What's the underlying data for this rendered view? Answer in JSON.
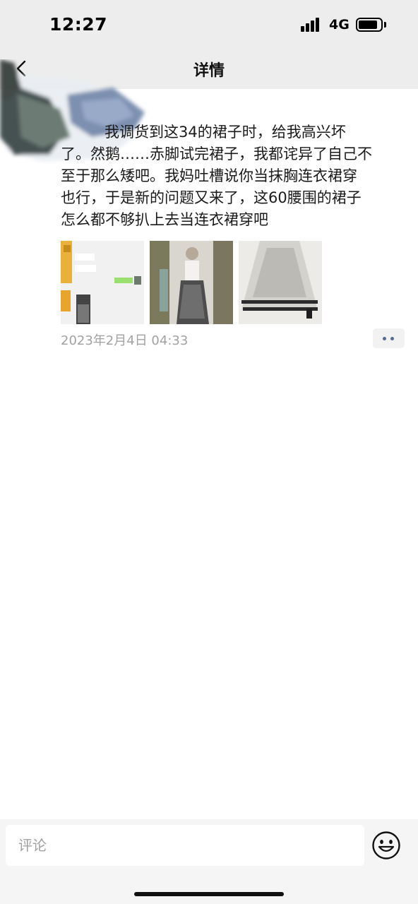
{
  "status_bar": {
    "time": "12:27",
    "network": "4G",
    "battery_level": 0.75
  },
  "nav": {
    "title": "详情",
    "back_icon": "chevron-left-icon"
  },
  "post": {
    "lines": [
      "我调货到这34的裙子时，给我高兴坏",
      "了。然鹅……赤脚试完裙子，我都诧异了自己不",
      "至于那么矮吧。我妈吐槽说你当抹胸连衣裙穿",
      "也行，于是新的问题又来了，这60腰围的裙子",
      "怎么都不够扒上去当连衣裙穿吧"
    ],
    "images": [
      {
        "name": "chat-screenshot-thumbnail"
      },
      {
        "name": "skirt-mirror-photo-thumbnail"
      },
      {
        "name": "skirt-hem-photo-thumbnail"
      }
    ],
    "date": "2023年2月4日 04:33",
    "more_icon": "more-dots-icon"
  },
  "comment_bar": {
    "placeholder": "评论",
    "emoji_icon": "emoji-smile-icon"
  },
  "colors": {
    "bar_bg": "#ededed",
    "link_blue": "#566b94",
    "date_gray": "#a2a2a2"
  }
}
